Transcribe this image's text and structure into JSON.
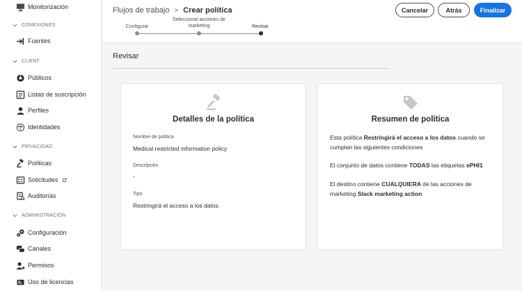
{
  "sidebar": {
    "top_item": {
      "label": "Monitorización",
      "icon": "monitor-icon"
    },
    "sections": [
      {
        "label": "CONEXIONES",
        "items": [
          {
            "label": "Fuentes",
            "icon": "sources-icon"
          }
        ]
      },
      {
        "label": "CLIENT",
        "items": [
          {
            "label": "Públicos",
            "icon": "audiences-icon"
          },
          {
            "label": "Listas de suscripción",
            "icon": "subscription-list-icon"
          },
          {
            "label": "Perfiles",
            "icon": "profile-icon"
          },
          {
            "label": "Identidades",
            "icon": "identities-icon"
          }
        ]
      },
      {
        "label": "PRIVACIDAD",
        "items": [
          {
            "label": "Políticas",
            "icon": "gavel-icon"
          },
          {
            "label": "Solicitudes",
            "icon": "requests-icon",
            "external": true
          },
          {
            "label": "Auditorías",
            "icon": "audits-icon"
          }
        ]
      },
      {
        "label": "ADMINISTRACIÓN",
        "items": [
          {
            "label": "Configuración",
            "icon": "gears-icon"
          },
          {
            "label": "Canales",
            "icon": "channels-icon"
          },
          {
            "label": "Permisos",
            "icon": "permissions-icon"
          },
          {
            "label": "Uso de licencias",
            "icon": "license-icon"
          }
        ]
      }
    ]
  },
  "header": {
    "breadcrumb": {
      "parent": "Flujos de trabajo",
      "current": "Crear política"
    },
    "stepper": {
      "steps": [
        "Configurar",
        "Seleccionar acciones de marketing",
        "Revisar"
      ],
      "current_index": 2
    },
    "buttons": {
      "cancel": "Cancelar",
      "back": "Atrás",
      "finish": "Finalizar"
    }
  },
  "main": {
    "section_title": "Revisar",
    "details_card": {
      "title": "Detalles de la política",
      "icon": "gavel-icon",
      "fields": [
        {
          "label": "Nombre de política",
          "value": "Medical restricted information policy"
        },
        {
          "label": "Descripción",
          "value": "-"
        },
        {
          "label": "Tipo",
          "value": "Restringirá el acceso a los datos"
        }
      ]
    },
    "summary_card": {
      "title": "Resumen de política",
      "icon": "tag-icon",
      "p1": {
        "a": "Esta política ",
        "b": "Restringirá el acceso a los datos",
        "c": " cuando se cumplan las siguientes condiciones"
      },
      "p2": {
        "a": "El conjunto de datos contiene ",
        "b": "TODAS",
        "c": " las etiquetas ",
        "d": "ePHI1"
      },
      "p3": {
        "a": "El destino contiene ",
        "b": "CUALQUIERA",
        "c": " de las acciones de marketing ",
        "d": "Slack marketing action"
      }
    }
  },
  "colors": {
    "accent": "#1473e6",
    "background": "#f5f5f5",
    "card": "#ffffff"
  }
}
